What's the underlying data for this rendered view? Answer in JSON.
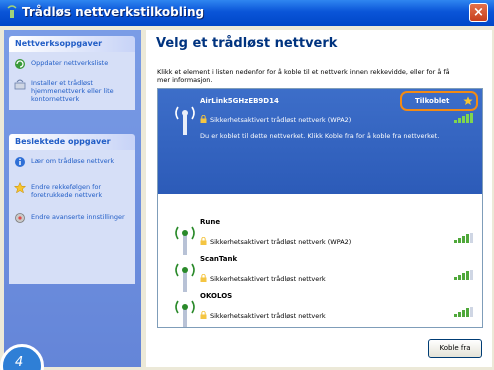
{
  "window": {
    "title": "Trådløs nettverkstilkobling",
    "close_label": "×"
  },
  "sidebar": {
    "groups": [
      {
        "title": "Nettverksoppgaver",
        "items": [
          {
            "label": "Oppdater nettverksliste",
            "icon": "refresh-icon"
          },
          {
            "label": "Installer et trådløst hjemmenettverk eller lite kontornettverk",
            "icon": "setup-icon"
          }
        ]
      },
      {
        "title": "Beslektede oppgaver",
        "items": [
          {
            "label": "Lær om trådløse nettverk",
            "icon": "info-icon"
          },
          {
            "label": "Endre rekkefølgen for foretrukkede nettverk",
            "icon": "star-icon"
          },
          {
            "label": "Endre avanserte innstillinger",
            "icon": "settings-icon"
          }
        ]
      }
    ]
  },
  "main": {
    "heading": "Velg et trådløst nettverk",
    "description": "Klikk et element i listen nedenfor for å koble til et nettverk innen rekkevidde, eller for å få mer informasjon.",
    "networks": [
      {
        "name": "AirLink5GHzEB9D14",
        "security": "Sikkerhetsaktivert trådløst nettverk (WPA2)",
        "status": "Tilkoblet",
        "info": "Du er koblet til dette nettverket. Klikk Koble fra for å koble fra nettverket.",
        "selected": true,
        "signal": 1.0
      },
      {
        "name": "Rune",
        "security": "Sikkerhetsaktivert trådløst nettverk (WPA2)",
        "signal": 0.8
      },
      {
        "name": "ScanTank",
        "security": "Sikkerhetsaktivert trådløst nettverk",
        "signal": 0.8
      },
      {
        "name": "OKOLOS",
        "security": "Sikkerhetsaktivert trådløst nettverk",
        "signal": 0.8
      }
    ],
    "disconnect_label": "Koble fra"
  },
  "step_number": "4",
  "colors": {
    "titlebar": "#0a55d8",
    "sidebar": "#6485d8",
    "selected_row": "#3163c0",
    "highlight": "#f28a14"
  }
}
